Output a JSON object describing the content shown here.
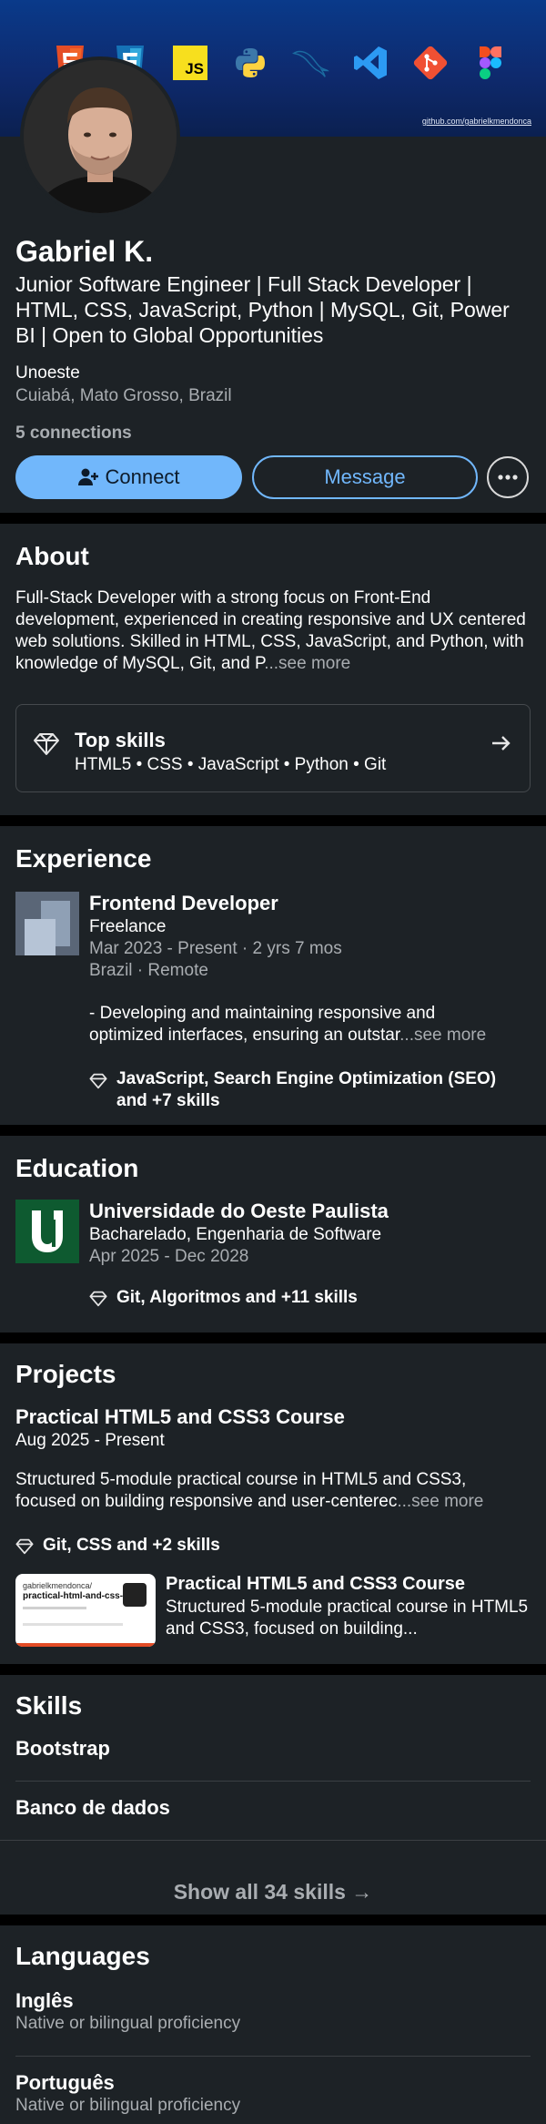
{
  "profile": {
    "banner_url": "github.com/gabrielkmendonca",
    "tech_icons": [
      "html5-icon",
      "css3-icon",
      "javascript-icon",
      "python-icon",
      "mysql-icon",
      "vscode-icon",
      "git-icon",
      "figma-icon"
    ],
    "js_badge": "JS",
    "name": "Gabriel K.",
    "headline": "Junior Software Engineer | Full Stack Developer | HTML, CSS, JavaScript, Python | MySQL, Git, Power BI | Open to Global Opportunities",
    "company": "Unoeste",
    "location": "Cuiabá, Mato Grosso, Brazil",
    "connections": "5 connections",
    "connect_label": "Connect",
    "message_label": "Message"
  },
  "about": {
    "title": "About",
    "text": "Full-Stack Developer with a strong focus on Front-End development, experienced in creating responsive and UX centered web solutions. Skilled in HTML, CSS, JavaScript, and Python, with knowledge of MySQL, Git, and P",
    "see_more": "...see more",
    "top_skills_label": "Top skills",
    "top_skills": "HTML5 • CSS • JavaScript • Python • Git"
  },
  "experience": {
    "title": "Experience",
    "role": "Frontend Developer",
    "company": "Freelance",
    "dates": "Mar 2023 - Present · 2 yrs 7 mos",
    "place": "Brazil · Remote",
    "desc_line1": "- Developing and maintaining responsive and",
    "desc_line2": "optimized interfaces, ensuring an outstar",
    "see_more": "...see more",
    "skills": "JavaScript, Search Engine Optimization (SEO) and +7 skills"
  },
  "education": {
    "title": "Education",
    "school": "Universidade do Oeste Paulista",
    "degree": "Bacharelado, Engenharia de Software",
    "dates": "Apr 2025 - Dec 2028",
    "skills": "Git, Algoritmos and +11 skills"
  },
  "projects": {
    "title": "Projects",
    "name": "Practical HTML5 and CSS3 Course",
    "dates": "Aug 2025 - Present",
    "desc_line1": "Structured 5-module practical course in HTML5 and CSS3,",
    "desc_line2": "focused on building responsive and user-centerec",
    "see_more": "...see more",
    "skills": "Git, CSS and +2 skills",
    "thumb_repo_owner": "gabrielkmendonca/",
    "thumb_repo_name": "practical-html-and-css-...",
    "card_title": "Practical HTML5 and CSS3 Course",
    "card_desc": "Structured 5-module practical course in HTML5 and CSS3, focused on building..."
  },
  "skills": {
    "title": "Skills",
    "items": [
      "Bootstrap",
      "Banco de dados"
    ],
    "show_all": "Show all 34 skills →"
  },
  "languages": {
    "title": "Languages",
    "items": [
      {
        "name": "Inglês",
        "level": "Native or bilingual proficiency"
      },
      {
        "name": "Português",
        "level": "Native or bilingual proficiency"
      }
    ]
  }
}
